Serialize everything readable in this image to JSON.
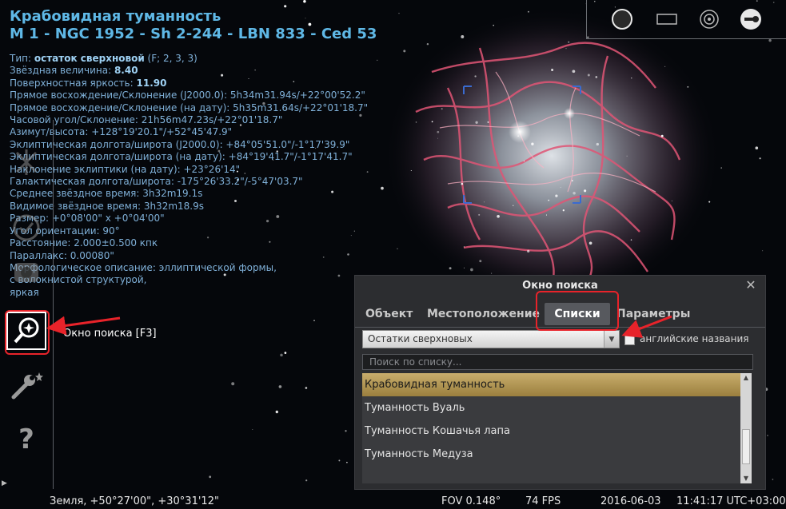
{
  "object": {
    "name": "Крабовидная туманность",
    "designations": "M 1 - NGC 1952 - Sh 2-244 - LBN 833 - Ced 53",
    "rows": [
      {
        "label": "Тип: ",
        "value": "остаток сверхновой",
        "rest": " (F; 2, 3, 3)"
      },
      {
        "label": "Звёздная величина: ",
        "value": "8.40",
        "rest": ""
      },
      {
        "label": "Поверхностная яркость: ",
        "value": "11.90",
        "rest": ""
      },
      {
        "label": "Прямое восхождение/Склонение (J2000.0): 5h34m31.94s/+22°00'52.2\"",
        "value": "",
        "rest": ""
      },
      {
        "label": "Прямое восхождение/Склонение (на дату): 5h35m31.64s/+22°01'18.7\"",
        "value": "",
        "rest": ""
      },
      {
        "label": "Часовой угол/Склонение: 21h56m47.23s/+22°01'18.7\"",
        "value": "",
        "rest": ""
      },
      {
        "label": "Азимут/высота: +128°19'20.1\"/+52°45'47.9\"",
        "value": "",
        "rest": ""
      },
      {
        "label": "Эклиптическая долгота/широта (J2000.0): +84°05'51.0\"/-1°17'39.9\"",
        "value": "",
        "rest": ""
      },
      {
        "label": "Эклиптическая долгота/широта (на дату): +84°19'41.7\"/-1°17'41.7\"",
        "value": "",
        "rest": ""
      },
      {
        "label": "Наклонение эклиптики (на дату): +23°26'14\"",
        "value": "",
        "rest": ""
      },
      {
        "label": "Галактическая долгота/широта: -175°26'33.2\"/-5°47'03.7\"",
        "value": "",
        "rest": ""
      },
      {
        "label": "Среднее звёздное время: 3h32m19.1s",
        "value": "",
        "rest": ""
      },
      {
        "label": "Видимое звёздное время: 3h32m18.9s",
        "value": "",
        "rest": ""
      },
      {
        "label": "Размер: +0°08'00\" x +0°04'00\"",
        "value": "",
        "rest": ""
      },
      {
        "label": "Угол ориентации: 90°",
        "value": "",
        "rest": ""
      },
      {
        "label": "Расстояние: 2.000±0.500 кпк",
        "value": "",
        "rest": ""
      },
      {
        "label": "Параллакс: 0.00080\"",
        "value": "",
        "rest": ""
      },
      {
        "label": "Морфологическое описание: эллиптической формы,",
        "value": "",
        "rest": ""
      },
      {
        "label": "с волокнистой структурой,",
        "value": "",
        "rest": ""
      },
      {
        "label": "яркая",
        "value": "",
        "rest": ""
      }
    ]
  },
  "left_toolbar": {
    "tooltip": "Окно поиска  [F3]",
    "buttons": [
      "location-icon",
      "datetime-icon",
      "sky-view-icon",
      "search-icon",
      "settings-icon",
      "help-icon"
    ]
  },
  "top_toolbar": {
    "icons": [
      "filled-circle-icon",
      "rectangle-icon",
      "target-icon",
      "wrench-circle-icon"
    ]
  },
  "search_window": {
    "title": "Окно поиска",
    "tabs": [
      "Объект",
      "Местоположение",
      "Списки",
      "Параметры"
    ],
    "selected_tab": "Списки",
    "list_select": "Остатки сверхновых",
    "english_names_label": "английские названия",
    "search_placeholder": "Поиск по списку...",
    "items": [
      "Крабовидная туманность",
      "Туманность Вуаль",
      "Туманность Кошачья лапа",
      "Туманность Медуза"
    ],
    "selected_item": "Крабовидная туманность"
  },
  "status_bar": {
    "location": "Земля, +50°27'00\", +30°31'12\"",
    "fov": "FOV 0.148°",
    "fps": "74 FPS",
    "date": "2016-06-03",
    "time": "11:41:17 UTC+03:00"
  },
  "colors": {
    "info_text": "#7fb0d8",
    "title_text": "#5fb8e6",
    "annotation_red": "#e8232a",
    "selected_item": "#b8995a"
  }
}
